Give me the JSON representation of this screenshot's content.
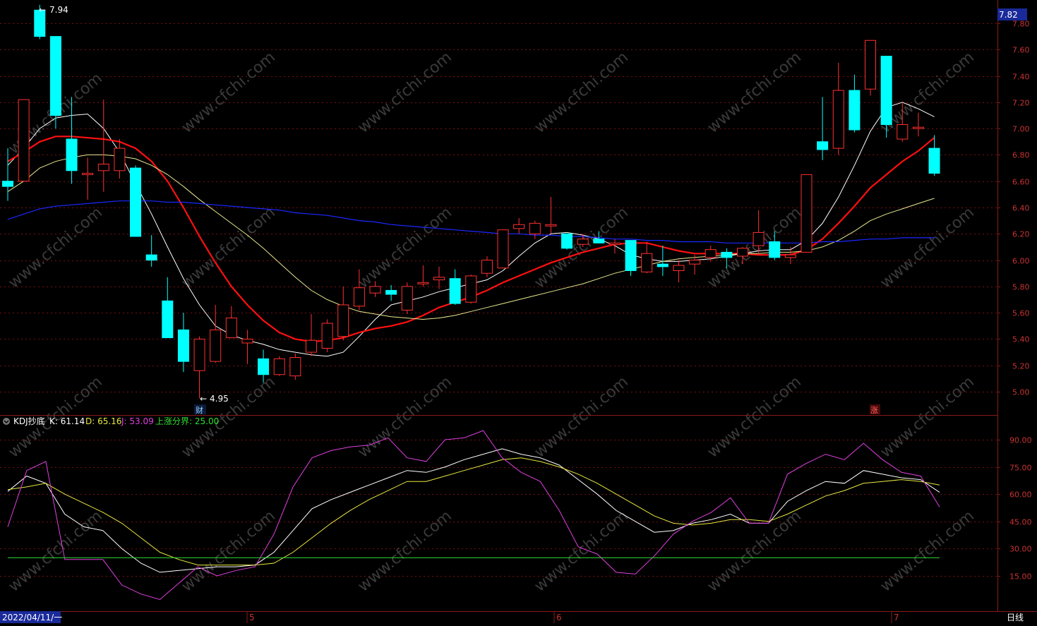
{
  "colors": {
    "bg": "#000000",
    "frame": "#8b1a1a",
    "grid": "#7a1010",
    "up": "#ff3030",
    "down": "#00ffff",
    "ma_white": "#ffffff",
    "ma_red": "#ff1010",
    "ma_yellow": "#e8e890",
    "ma_blue": "#1a28ff",
    "k": "#ffffff",
    "d": "#e8e840",
    "j": "#e040e0",
    "line25": "#30e030",
    "axis_text": "#c83232",
    "label_text": "#ffffff"
  },
  "main_panel": {
    "price_axis_ticks": [
      "7.80",
      "7.60",
      "7.40",
      "7.20",
      "7.00",
      "6.80",
      "6.60",
      "6.40",
      "6.20",
      "6.00",
      "5.80",
      "5.60",
      "5.40",
      "5.20",
      "5.00"
    ],
    "last_price_tag": "7.82",
    "high_annotation": "7.94",
    "low_annotation": "4.95",
    "marker_cai": "财",
    "marker_zhang": "涨"
  },
  "kdj_panel": {
    "title": "KDJ抄底",
    "k_label": "K: 61.14",
    "d_label": "D: 65.16",
    "j_label": "J: 53.09",
    "line_label": "上涨分界: 25.00",
    "axis_ticks": [
      "90.00",
      "75.00",
      "60.00",
      "45.00",
      "30.00",
      "15.00"
    ]
  },
  "bottom_bar": {
    "date_label": "2022/04/11/一",
    "month_labels": [
      "5",
      "6",
      "7"
    ],
    "period_label": "日线"
  },
  "watermark": "www.cfchi.com",
  "chart_data": [
    {
      "type": "candlestick",
      "title": "",
      "ylim": [
        4.8,
        7.85
      ],
      "candles": [
        {
          "o": 6.6,
          "c": 6.56,
          "h": 6.85,
          "l": 6.45
        },
        {
          "o": 6.6,
          "c": 7.22,
          "h": 7.22,
          "l": 6.6
        },
        {
          "o": 7.9,
          "c": 7.7,
          "h": 7.94,
          "l": 7.68
        },
        {
          "o": 7.7,
          "c": 7.1,
          "h": 7.7,
          "l": 7.0
        },
        {
          "o": 6.92,
          "c": 6.68,
          "h": 7.24,
          "l": 6.58
        },
        {
          "o": 6.66,
          "c": 6.66,
          "h": 6.78,
          "l": 6.46
        },
        {
          "o": 6.68,
          "c": 6.73,
          "h": 7.22,
          "l": 6.52
        },
        {
          "o": 6.68,
          "c": 6.85,
          "h": 6.92,
          "l": 6.62
        },
        {
          "o": 6.7,
          "c": 6.18,
          "h": 6.72,
          "l": 6.18
        },
        {
          "o": 6.04,
          "c": 6.0,
          "h": 6.19,
          "l": 5.95
        },
        {
          "o": 5.69,
          "c": 5.41,
          "h": 5.87,
          "l": 5.41
        },
        {
          "o": 5.47,
          "c": 5.23,
          "h": 5.6,
          "l": 5.15
        },
        {
          "o": 5.16,
          "c": 5.4,
          "h": 5.42,
          "l": 4.95
        },
        {
          "o": 5.23,
          "c": 5.47,
          "h": 5.66,
          "l": 5.22
        },
        {
          "o": 5.41,
          "c": 5.56,
          "h": 5.65,
          "l": 5.41
        },
        {
          "o": 5.37,
          "c": 5.4,
          "h": 5.47,
          "l": 5.21
        },
        {
          "o": 5.25,
          "c": 5.13,
          "h": 5.32,
          "l": 5.07
        },
        {
          "o": 5.13,
          "c": 5.25,
          "h": 5.27,
          "l": 5.12
        },
        {
          "o": 5.12,
          "c": 5.26,
          "h": 5.29,
          "l": 5.09
        },
        {
          "o": 5.3,
          "c": 5.39,
          "h": 5.59,
          "l": 5.27
        },
        {
          "o": 5.33,
          "c": 5.52,
          "h": 5.55,
          "l": 5.3
        },
        {
          "o": 5.42,
          "c": 5.66,
          "h": 5.8,
          "l": 5.39
        },
        {
          "o": 5.65,
          "c": 5.79,
          "h": 5.93,
          "l": 5.62
        },
        {
          "o": 5.75,
          "c": 5.8,
          "h": 5.84,
          "l": 5.72
        },
        {
          "o": 5.77,
          "c": 5.74,
          "h": 5.81,
          "l": 5.69
        },
        {
          "o": 5.62,
          "c": 5.8,
          "h": 5.83,
          "l": 5.59
        },
        {
          "o": 5.82,
          "c": 5.83,
          "h": 5.96,
          "l": 5.8
        },
        {
          "o": 5.85,
          "c": 5.87,
          "h": 5.95,
          "l": 5.78
        },
        {
          "o": 5.86,
          "c": 5.67,
          "h": 5.93,
          "l": 5.66
        },
        {
          "o": 5.68,
          "c": 5.88,
          "h": 5.89,
          "l": 5.67
        },
        {
          "o": 5.9,
          "c": 6.0,
          "h": 6.03,
          "l": 5.87
        },
        {
          "o": 5.94,
          "c": 6.23,
          "h": 6.23,
          "l": 5.94
        },
        {
          "o": 6.24,
          "c": 6.27,
          "h": 6.32,
          "l": 6.2
        },
        {
          "o": 6.2,
          "c": 6.28,
          "h": 6.3,
          "l": 6.16
        },
        {
          "o": 6.27,
          "c": 6.27,
          "h": 6.48,
          "l": 6.2
        },
        {
          "o": 6.2,
          "c": 6.09,
          "h": 6.2,
          "l": 6.08
        },
        {
          "o": 6.12,
          "c": 6.16,
          "h": 6.2,
          "l": 6.1
        },
        {
          "o": 6.16,
          "c": 6.13,
          "h": 6.22,
          "l": 6.13
        },
        {
          "o": 6.13,
          "c": 6.13,
          "h": 6.16,
          "l": 6.05
        },
        {
          "o": 6.15,
          "c": 5.92,
          "h": 6.15,
          "l": 5.88
        },
        {
          "o": 5.91,
          "c": 6.05,
          "h": 6.14,
          "l": 5.9
        },
        {
          "o": 5.97,
          "c": 5.95,
          "h": 6.11,
          "l": 5.88
        },
        {
          "o": 5.92,
          "c": 5.96,
          "h": 6.0,
          "l": 5.83
        },
        {
          "o": 5.97,
          "c": 6.0,
          "h": 6.04,
          "l": 5.89
        },
        {
          "o": 6.02,
          "c": 6.08,
          "h": 6.11,
          "l": 5.99
        },
        {
          "o": 6.06,
          "c": 6.02,
          "h": 6.09,
          "l": 5.94
        },
        {
          "o": 6.03,
          "c": 6.09,
          "h": 6.1,
          "l": 5.97
        },
        {
          "o": 6.11,
          "c": 6.21,
          "h": 6.38,
          "l": 6.05
        },
        {
          "o": 6.14,
          "c": 6.02,
          "h": 6.22,
          "l": 6.0
        },
        {
          "o": 6.02,
          "c": 6.04,
          "h": 6.1,
          "l": 5.97
        },
        {
          "o": 6.06,
          "c": 6.65,
          "h": 6.65,
          "l": 6.06
        },
        {
          "o": 6.9,
          "c": 6.84,
          "h": 7.24,
          "l": 6.76
        },
        {
          "o": 6.85,
          "c": 7.29,
          "h": 7.5,
          "l": 6.8
        },
        {
          "o": 7.29,
          "c": 6.99,
          "h": 7.41,
          "l": 6.97
        },
        {
          "o": 7.3,
          "c": 7.67,
          "h": 7.67,
          "l": 7.25
        },
        {
          "o": 7.55,
          "c": 7.03,
          "h": 7.55,
          "l": 6.93
        },
        {
          "o": 6.92,
          "c": 7.03,
          "h": 7.2,
          "l": 6.9
        },
        {
          "o": 7.01,
          "c": 7.01,
          "h": 7.12,
          "l": 6.94
        },
        {
          "o": 6.85,
          "c": 6.66,
          "h": 6.95,
          "l": 6.64
        }
      ],
      "moving_averages": [
        {
          "color": "white",
          "values": [
            6.72,
            6.85,
            7.0,
            7.08,
            7.1,
            7.11,
            7.0,
            6.82,
            6.58,
            6.35,
            6.1,
            5.86,
            5.66,
            5.5,
            5.43,
            5.39,
            5.36,
            5.32,
            5.3,
            5.28,
            5.27,
            5.3,
            5.42,
            5.55,
            5.66,
            5.69,
            5.72,
            5.76,
            5.79,
            5.82,
            5.85,
            5.92,
            6.03,
            6.13,
            6.2,
            6.21,
            6.19,
            6.16,
            6.11,
            6.04,
            6.01,
            5.99,
            5.99,
            6.0,
            6.01,
            6.03,
            6.05,
            6.07,
            6.08,
            6.08,
            6.15,
            6.28,
            6.48,
            6.72,
            6.98,
            7.16,
            7.2,
            7.15,
            7.09
          ]
        },
        {
          "color": "red",
          "values": [
            6.75,
            6.82,
            6.9,
            6.94,
            6.94,
            6.93,
            6.92,
            6.9,
            6.85,
            6.75,
            6.6,
            6.4,
            6.18,
            5.98,
            5.8,
            5.66,
            5.54,
            5.45,
            5.4,
            5.38,
            5.39,
            5.41,
            5.45,
            5.48,
            5.5,
            5.53,
            5.58,
            5.64,
            5.68,
            5.72,
            5.77,
            5.83,
            5.88,
            5.93,
            5.98,
            6.02,
            6.06,
            6.09,
            6.12,
            6.13,
            6.13,
            6.1,
            6.07,
            6.05,
            6.05,
            6.05,
            6.05,
            6.04,
            6.04,
            6.04,
            6.08,
            6.16,
            6.28,
            6.41,
            6.55,
            6.65,
            6.75,
            6.83,
            6.93
          ]
        },
        {
          "color": "yellow",
          "values": [
            6.52,
            6.6,
            6.7,
            6.75,
            6.78,
            6.8,
            6.8,
            6.79,
            6.77,
            6.72,
            6.65,
            6.56,
            6.46,
            6.37,
            6.28,
            6.19,
            6.09,
            5.98,
            5.87,
            5.77,
            5.7,
            5.65,
            5.61,
            5.59,
            5.57,
            5.56,
            5.55,
            5.56,
            5.58,
            5.61,
            5.64,
            5.67,
            5.7,
            5.73,
            5.76,
            5.79,
            5.82,
            5.86,
            5.9,
            5.93,
            5.96,
            5.99,
            6.01,
            6.02,
            6.03,
            6.04,
            6.05,
            6.05,
            6.06,
            6.06,
            6.07,
            6.1,
            6.15,
            6.22,
            6.3,
            6.35,
            6.39,
            6.43,
            6.47
          ]
        },
        {
          "color": "blue",
          "values": [
            6.31,
            6.35,
            6.39,
            6.41,
            6.42,
            6.43,
            6.44,
            6.45,
            6.45,
            6.45,
            6.44,
            6.44,
            6.43,
            6.42,
            6.41,
            6.4,
            6.39,
            6.38,
            6.36,
            6.35,
            6.34,
            6.32,
            6.3,
            6.29,
            6.27,
            6.26,
            6.25,
            6.24,
            6.23,
            6.22,
            6.21,
            6.2,
            6.2,
            6.19,
            6.19,
            6.18,
            6.18,
            6.17,
            6.16,
            6.16,
            6.15,
            6.15,
            6.14,
            6.14,
            6.14,
            6.13,
            6.13,
            6.13,
            6.13,
            6.13,
            6.13,
            6.14,
            6.14,
            6.15,
            6.16,
            6.16,
            6.17,
            6.17,
            6.17
          ]
        }
      ]
    },
    {
      "type": "line",
      "title": "KDJ抄底",
      "ylim": [
        0,
        102
      ],
      "series": [
        {
          "name": "K",
          "values": [
            61.5,
            70,
            66,
            49,
            42,
            40,
            30,
            22,
            17,
            18,
            19,
            20,
            20,
            21,
            28,
            40,
            52,
            57,
            61,
            65,
            69,
            73,
            72,
            75,
            79,
            82,
            85,
            82,
            80,
            76,
            68,
            60,
            51,
            45,
            39,
            40,
            44,
            46,
            49,
            44,
            44,
            56,
            62,
            67,
            66,
            73,
            71,
            69,
            68,
            61
          ]
        },
        {
          "name": "D",
          "values": [
            62.5,
            64,
            66,
            60,
            55,
            50,
            44,
            36,
            28,
            24,
            21,
            21,
            21,
            21,
            22,
            28,
            36,
            44,
            51,
            57,
            62,
            67,
            67,
            70,
            73,
            76,
            79,
            80,
            78,
            75,
            71,
            66,
            60,
            54,
            48,
            44,
            43,
            44,
            46,
            46,
            45,
            49,
            54,
            59,
            62,
            66,
            67,
            68,
            67,
            65
          ]
        },
        {
          "name": "J",
          "values": [
            42,
            73,
            78,
            24,
            24,
            24,
            10,
            5,
            2,
            11,
            20,
            15,
            18,
            20,
            38,
            64,
            80,
            84,
            86,
            87,
            91,
            80,
            78,
            90,
            91,
            95,
            80,
            72,
            67,
            51,
            31,
            27,
            17,
            16,
            26,
            38,
            45,
            50,
            58,
            44,
            44,
            71,
            77,
            82,
            79,
            88,
            79,
            72,
            70,
            53
          ]
        },
        {
          "name": "上涨分界",
          "values": [
            25
          ]
        }
      ]
    }
  ]
}
